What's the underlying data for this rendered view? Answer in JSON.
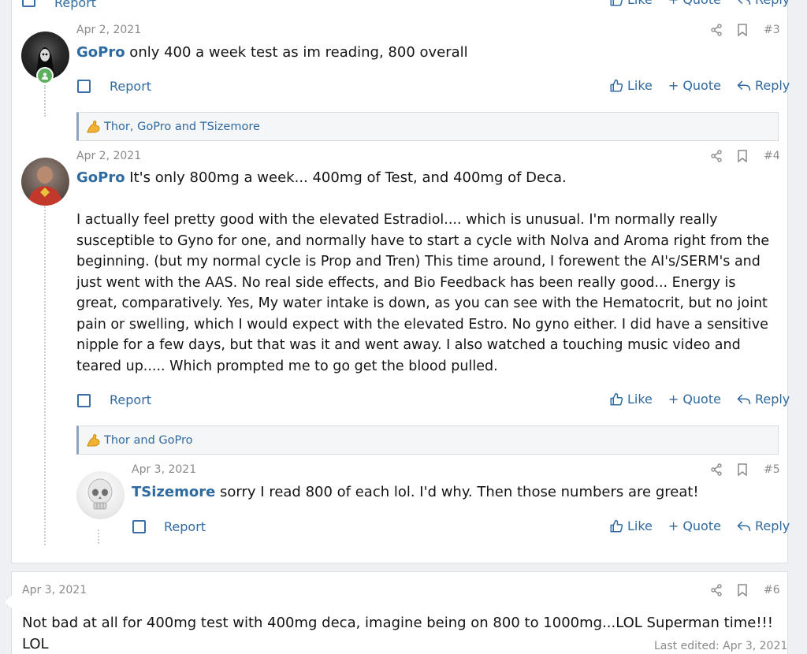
{
  "top_partial": {
    "report": "Report",
    "like": "Like",
    "quote": "Quote",
    "reply": "Reply"
  },
  "posts": [
    {
      "date": "Apr 2, 2021",
      "number": "#3",
      "username": "GoPro",
      "text": " only 400 a week test as im reading, 800 overall",
      "report": "Report",
      "like": "Like",
      "quote": "Quote",
      "reply": "Reply",
      "reactions": "Thor, GoPro and TSizemore"
    },
    {
      "date": "Apr 2, 2021",
      "number": "#4",
      "username": "GoPro",
      "text": " It's only 800mg a week... 400mg of Test, and 400mg of Deca.",
      "paragraph": "I actually feel pretty good with the elevated Estradiol.... which is unusual. I'm normally really susceptible to Gyno for one, and normally have to start a cycle with Nolva and Aroma right from the beginning. (but my normal cycle is Prop and Tren) This time around, I forewent the AI's/SERM's and just went with the AAS. No real side effects, and Bio Feedback has been really good... Energy is great, comparatively. Yes, My water intake is down, as you can see with the Hematocrit, but no joint pain or swelling, which I would expect with the elevated Estro. No gyno either. I did have a sensitive nipple for a few days, but that was it and went away. I also watched a touching music video and teared up..... Which prompted me to go get the blood pulled.",
      "report": "Report",
      "like": "Like",
      "quote": "Quote",
      "reply": "Reply",
      "reactions": "Thor and GoPro"
    },
    {
      "date": "Apr 3, 2021",
      "number": "#5",
      "username": "TSizemore",
      "text": " sorry I read 800 of each lol. I'd why. Then those numbers are great!",
      "report": "Report",
      "like": "Like",
      "quote": "Quote",
      "reply": "Reply"
    },
    {
      "date": "Apr 3, 2021",
      "number": "#6",
      "text": "Not bad at all for 400mg test with 400mg deca, imagine being on 800 to 1000mg...LOL Superman time!!! LOL",
      "last_edited": "Last edited: Apr 3, 2021"
    }
  ],
  "colors": {
    "link": "#2f6aa0",
    "muted": "#8a8a8a",
    "online": "#5db05f"
  }
}
